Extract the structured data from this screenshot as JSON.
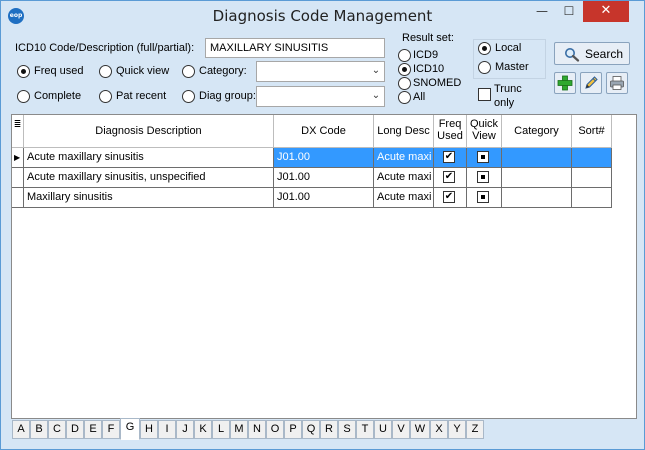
{
  "window": {
    "title": "Diagnosis Code Management",
    "app_icon_text": "eop",
    "controls": {
      "minimize": "—",
      "maximize": "☐",
      "close": "✕"
    }
  },
  "search": {
    "label": "ICD10 Code/Description (full/partial):",
    "value": "MAXILLARY SINUSITIS"
  },
  "filters": {
    "freq_used": "Freq used",
    "quick_view": "Quick view",
    "category": "Category:",
    "complete": "Complete",
    "pat_recent": "Pat recent",
    "diag_group": "Diag group:",
    "selected": "freq_used",
    "category_value": "",
    "diag_group_value": ""
  },
  "result_set": {
    "label": "Result set:",
    "options": [
      "ICD9",
      "ICD10",
      "SNOMED",
      "All"
    ],
    "selected": "ICD10"
  },
  "source": {
    "options": [
      "Local",
      "Master"
    ],
    "selected": "Local",
    "trunc_label_1": "Trunc",
    "trunc_label_2": "only",
    "trunc_checked": false
  },
  "toolbar": {
    "search_label": "Search",
    "search_icon": "magnifier-icon",
    "add_icon": "plus-icon",
    "edit_icon": "pencil-icon",
    "print_icon": "printer-icon"
  },
  "grid": {
    "columns": {
      "selector": "≣",
      "description": "Diagnosis Description",
      "dx_code": "DX Code",
      "long_desc": "Long Desc",
      "freq_used_1": "Freq",
      "freq_used_2": "Used",
      "quick_view_1": "Quick",
      "quick_view_2": "View",
      "category": "Category",
      "sort": "Sort#"
    },
    "rows": [
      {
        "description": "Acute maxillary sinusitis",
        "dx_code": "J01.00",
        "long_desc": "Acute maxi",
        "freq_used": true,
        "quick_view": true,
        "category": "",
        "sort": ""
      },
      {
        "description": "Acute maxillary sinusitis, unspecified",
        "dx_code": "J01.00",
        "long_desc": "Acute maxi",
        "freq_used": true,
        "quick_view": true,
        "category": "",
        "sort": ""
      },
      {
        "description": "Maxillary sinusitis",
        "dx_code": "J01.00",
        "long_desc": "Acute maxi",
        "freq_used": true,
        "quick_view": true,
        "category": "",
        "sort": ""
      }
    ],
    "selected_row": 0
  },
  "alpha_tabs": {
    "letters": [
      "A",
      "B",
      "C",
      "D",
      "E",
      "F",
      "G",
      "H",
      "I",
      "J",
      "K",
      "L",
      "M",
      "N",
      "O",
      "P",
      "Q",
      "R",
      "S",
      "T",
      "U",
      "V",
      "W",
      "X",
      "Y",
      "Z"
    ],
    "active": "G"
  }
}
